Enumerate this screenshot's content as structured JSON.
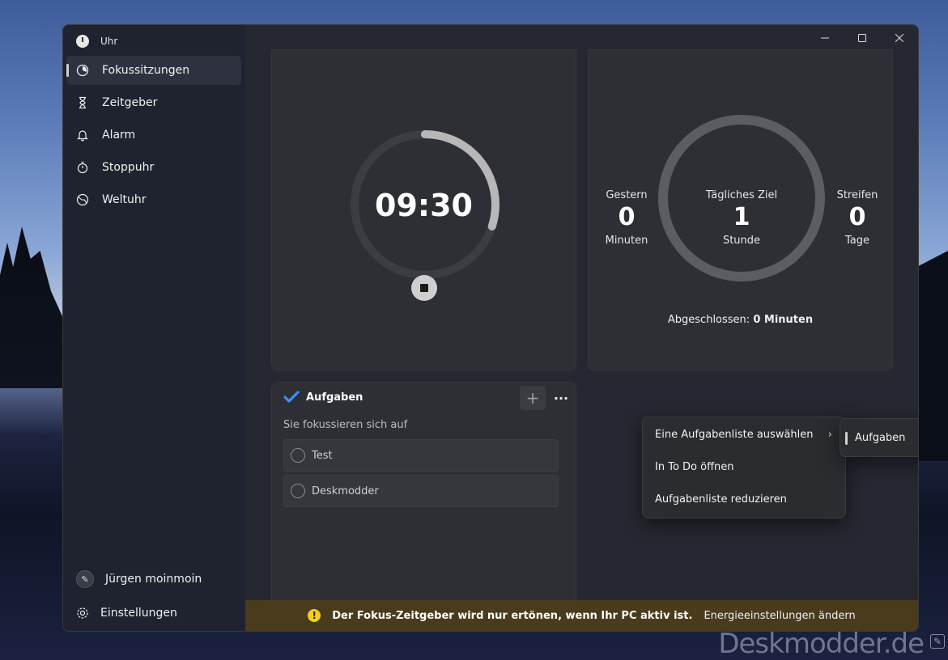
{
  "window": {
    "title": "Uhr"
  },
  "sidebar": {
    "items": [
      {
        "label": "Fokussitzungen",
        "icon": "focus-icon"
      },
      {
        "label": "Zeitgeber",
        "icon": "hourglass-icon"
      },
      {
        "label": "Alarm",
        "icon": "bell-icon"
      },
      {
        "label": "Stoppuhr",
        "icon": "stopwatch-icon"
      },
      {
        "label": "Weltuhr",
        "icon": "globe-icon"
      }
    ],
    "user": {
      "name": "Jürgen moinmoin"
    },
    "settings": {
      "label": "Einstellungen"
    }
  },
  "timer": {
    "display": "09:30",
    "progress_fraction": 0.3
  },
  "goal": {
    "yesterday": {
      "label": "Gestern",
      "value": "0",
      "unit": "Minuten"
    },
    "daily_goal": {
      "label": "Tägliches Ziel",
      "value": "1",
      "unit": "Stunde"
    },
    "streak": {
      "label": "Streifen",
      "value": "0",
      "unit": "Tage"
    },
    "completed_label": "Abgeschlossen:",
    "completed_value": "0 Minuten"
  },
  "tasks": {
    "title": "Aufgaben",
    "add_icon": "plus-icon",
    "more_icon": "more-icon",
    "subtitle": "Sie fokussieren sich auf",
    "items": [
      {
        "label": "Test"
      },
      {
        "label": "Deskmodder"
      }
    ]
  },
  "context_menu": {
    "items": [
      {
        "label": "Eine Aufgabenliste auswählen"
      },
      {
        "label": "In To Do öffnen"
      },
      {
        "label": "Aufgabenliste reduzieren"
      }
    ],
    "submenu": {
      "label": "Aufgaben"
    }
  },
  "banner": {
    "message": "Der Fokus-Zeitgeber wird nur ertönen, wenn Ihr PC aktiv ist.",
    "link": "Energieeinstellungen ändern"
  },
  "desktop": {
    "watermark": "Deskmodder.de"
  },
  "colors": {
    "accent": "#d0d0d0",
    "banner_bg": "#4a3b1c",
    "warn": "#f2cd1e"
  }
}
